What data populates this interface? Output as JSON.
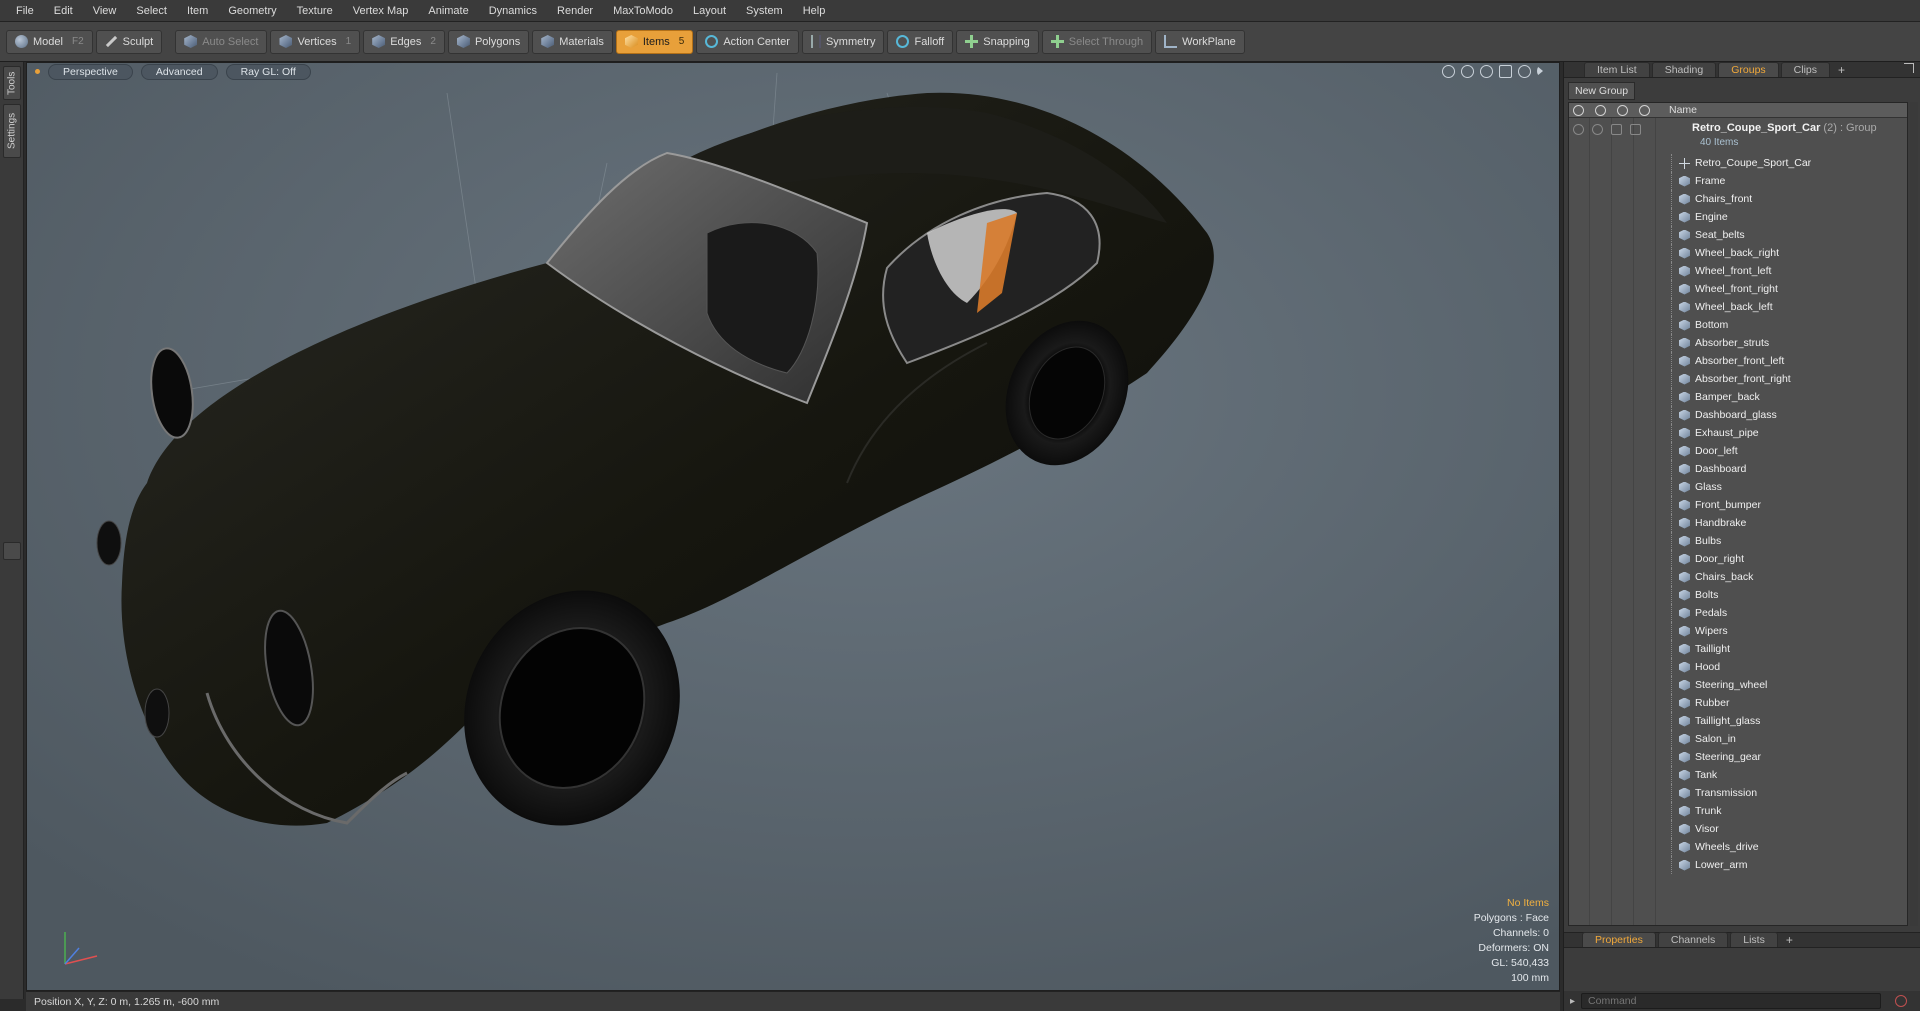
{
  "menu": [
    "File",
    "Edit",
    "View",
    "Select",
    "Item",
    "Geometry",
    "Texture",
    "Vertex Map",
    "Animate",
    "Dynamics",
    "Render",
    "MaxToModo",
    "Layout",
    "System",
    "Help"
  ],
  "toolbar": {
    "model": "Model",
    "model_key": "F2",
    "sculpt": "Sculpt",
    "auto_select": "Auto Select",
    "vertices": "Vertices",
    "vertices_key": "1",
    "edges": "Edges",
    "edges_key": "2",
    "polygons": "Polygons",
    "materials": "Materials",
    "items": "Items",
    "items_key": "5",
    "action_center": "Action Center",
    "symmetry": "Symmetry",
    "falloff": "Falloff",
    "snapping": "Snapping",
    "select_through": "Select Through",
    "workplane": "WorkPlane"
  },
  "left_tabs": {
    "tools": "Tools",
    "settings": "Settings"
  },
  "viewport": {
    "view": "Perspective",
    "shading": "Advanced",
    "raygl": "Ray GL: Off",
    "stats": {
      "selection": "No Items",
      "polygons": "Polygons : Face",
      "channels": "Channels: 0",
      "deformers": "Deformers: ON",
      "gl": "GL: 540,433",
      "scale": "100 mm"
    }
  },
  "status": {
    "position": "Position X, Y, Z:   0 m, 1.265 m, -600 mm"
  },
  "panel": {
    "tabs": [
      "Item List",
      "Shading",
      "Groups",
      "Clips"
    ],
    "active_tab": "Groups",
    "new_group": "New Group",
    "column_name": "Name",
    "group": {
      "name": "Retro_Coupe_Sport_Car",
      "count": "(2)",
      "type": ": Group",
      "sub": "40 Items"
    },
    "items": [
      "Retro_Coupe_Sport_Car",
      "Frame",
      "Chairs_front",
      "Engine",
      "Seat_belts",
      "Wheel_back_right",
      "Wheel_front_left",
      "Wheel_front_right",
      "Wheel_back_left",
      "Bottom",
      "Absorber_struts",
      "Absorber_front_left",
      "Absorber_front_right",
      "Bamper_back",
      "Dashboard_glass",
      "Exhaust_pipe",
      "Door_left",
      "Dashboard",
      "Glass",
      "Front_bumper",
      "Handbrake",
      "Bulbs",
      "Door_right",
      "Chairs_back",
      "Bolts",
      "Pedals",
      "Wipers",
      "Taillight",
      "Hood",
      "Steering_wheel",
      "Rubber",
      "Taillight_glass",
      "Salon_in",
      "Steering_gear",
      "Tank",
      "Transmission",
      "Trunk",
      "Visor",
      "Wheels_drive",
      "Lower_arm"
    ],
    "bottom_tabs": [
      "Properties",
      "Channels",
      "Lists"
    ],
    "bottom_active": "Properties",
    "command_placeholder": "Command"
  }
}
